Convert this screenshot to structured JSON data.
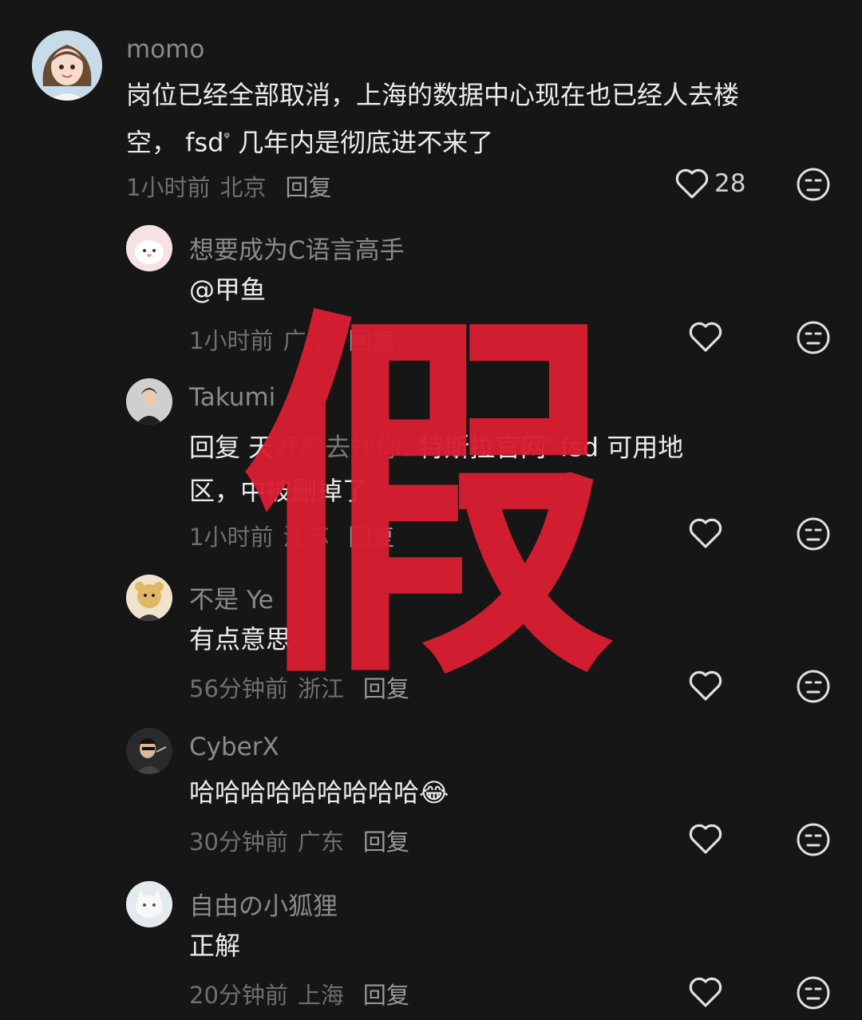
{
  "comments": [
    {
      "user": "momo",
      "text_line1": "岗位已经全部取消，上海的数据中心现在也已经人去楼",
      "text_line2_pre": "空， fsd",
      "text_line2_post": " 几年内是彻底进不来了",
      "time": "1小时前",
      "place": "北京",
      "reply": "回复",
      "likes": "28"
    },
    {
      "user": "想要成为C语言高手",
      "text": "@甲鱼",
      "time": "1小时前",
      "place": "广东",
      "reply": "回复"
    },
    {
      "user": "Takumi",
      "text_line1_pre": "回复 天",
      "text_line1_mid": "好的",
      "text_line1_mid2": "去找你: ",
      "text_line1_post": "特斯拉官网",
      "text_line1_end": " fsd 可用地",
      "text_line2_pre": "区，中",
      "text_line2_post": "被删掉了",
      "time": "1小时前",
      "place": "江苏",
      "reply": "回复"
    },
    {
      "user": "不是 Ye",
      "text": "有点意思",
      "time": "56分钟前",
      "place": "浙江",
      "reply": "回复"
    },
    {
      "user": "CyberX",
      "text": "哈哈哈哈哈哈哈哈哈",
      "emoji": "😂",
      "time": "30分钟前",
      "place": "广东",
      "reply": "回复"
    },
    {
      "user": "自由の小狐狸",
      "text": "正解",
      "time": "20分钟前",
      "place": "上海",
      "reply": "回复"
    }
  ],
  "stamp": {
    "text": "假",
    "color": "#d81e32"
  },
  "icons": {
    "search_mark": "ᵠ",
    "like": "heart-icon",
    "dislike": "meh-face-icon"
  }
}
